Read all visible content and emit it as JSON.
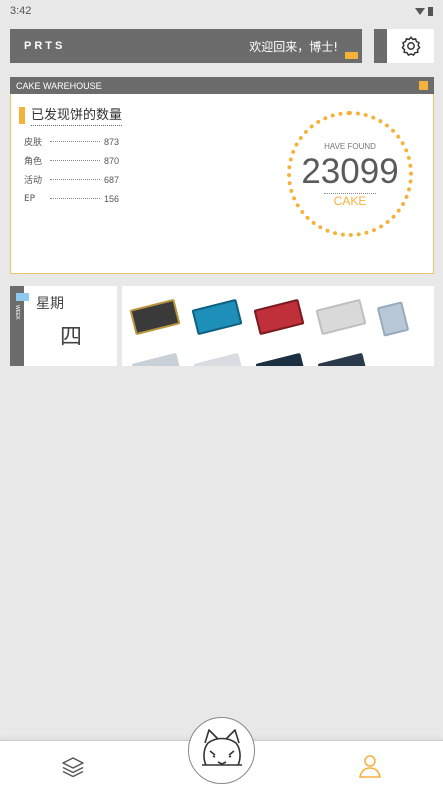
{
  "status_bar": {
    "time": "3:42"
  },
  "header": {
    "logo": "PRTS",
    "welcome": "欢迎回来，博士!"
  },
  "warehouse": {
    "bar_title": "CAKE WAREHOUSE",
    "section_title": "已发现饼的数量",
    "stats": [
      {
        "label": "皮肤",
        "value": "873"
      },
      {
        "label": "角色",
        "value": "870"
      },
      {
        "label": "活动",
        "value": "687"
      },
      {
        "label": "EP",
        "value": "156"
      }
    ],
    "found_label": "HAVE FOUND",
    "found_count": "23099",
    "found_unit": "CAKE"
  },
  "week": {
    "side_text": "WEEK",
    "label": "星期",
    "day": "四"
  },
  "colors": {
    "accent": "#f5b23b",
    "header_gray": "#6c6c6c",
    "week_blue": "#8fc8f0"
  },
  "icons": [
    "settings-gear-icon",
    "layers-icon",
    "mascot-icon",
    "user-icon"
  ]
}
